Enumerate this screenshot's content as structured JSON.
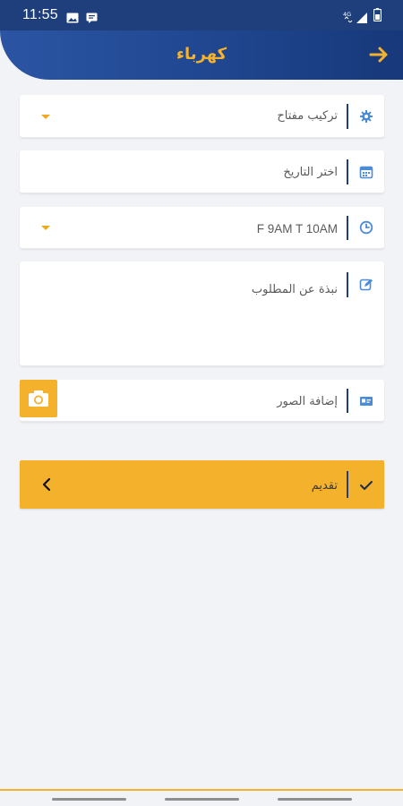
{
  "status_bar": {
    "time": "11:55",
    "left_icons": [
      "image-icon",
      "message-icon"
    ],
    "right_icons": [
      "4g-icon",
      "signal-icon",
      "battery-icon"
    ]
  },
  "header": {
    "title": "كهرباء",
    "back_icon": "arrow-right-icon"
  },
  "form": {
    "service": {
      "value": "تركيب مفتاح",
      "icon": "gear-icon"
    },
    "date": {
      "placeholder": "اختر التاريخ",
      "icon": "calendar-icon"
    },
    "time": {
      "value": "F 9AM T 10AM",
      "icon": "clock-icon"
    },
    "description": {
      "placeholder": "نبذة عن المطلوب",
      "icon": "edit-icon"
    },
    "photos": {
      "label": "إضافة الصور",
      "icon": "image-card-icon",
      "button_icon": "camera-icon"
    }
  },
  "submit": {
    "label": "تقديم",
    "check_icon": "check-icon",
    "chevron_icon": "chevron-left-icon"
  },
  "colors": {
    "primary": "#1e3f7c",
    "accent": "#f4b12b",
    "icon_blue": "#4c8bd6",
    "background": "#f1f3f6"
  }
}
